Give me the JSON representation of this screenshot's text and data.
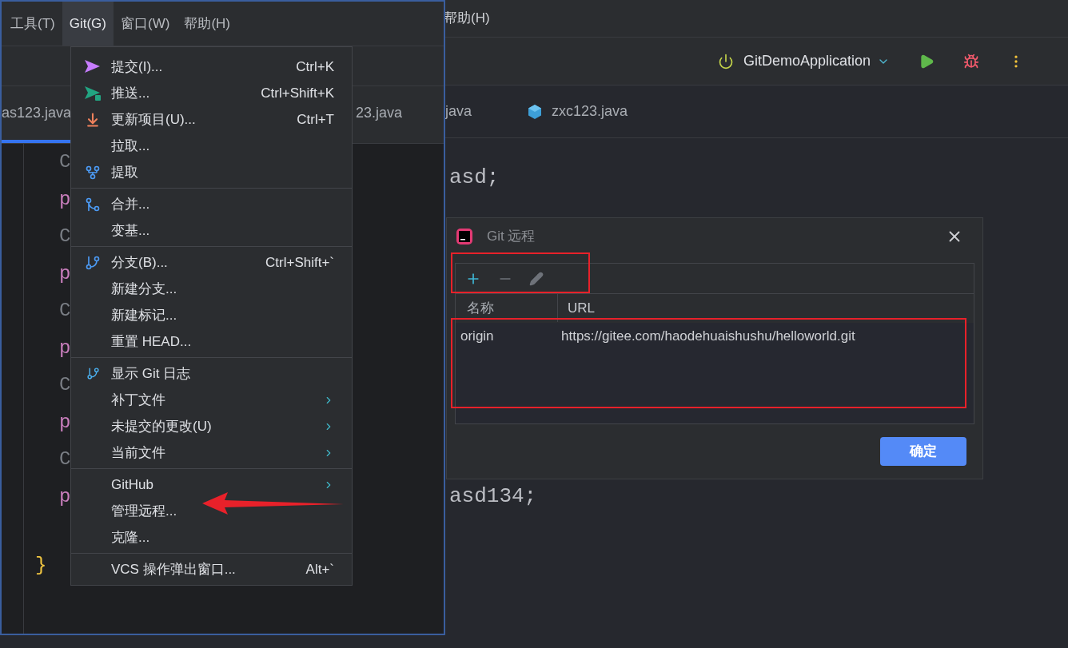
{
  "background_window": {
    "menu_tail": "帮助(H)",
    "run_config": "GitDemoApplication",
    "tabs": [
      {
        "label": "java",
        "icon": false
      },
      {
        "label": "zxc123.java",
        "icon": true
      }
    ],
    "code_lines": [
      "asd;",
      "asd134;"
    ]
  },
  "front_window": {
    "menu_bar": [
      {
        "label": "工具(T)",
        "selected": false
      },
      {
        "label": "Git(G)",
        "selected": true
      },
      {
        "label": "窗口(W)",
        "selected": false
      },
      {
        "label": "帮助(H)",
        "selected": false
      }
    ],
    "tabs": [
      {
        "label": "as123.java",
        "selected": true
      },
      {
        "label": "23.java",
        "selected": false
      }
    ],
    "code_fragments": [
      "C",
      "p",
      "C",
      "p",
      "C",
      "p",
      "C",
      "p",
      "C",
      "p"
    ],
    "closing_brace": "}"
  },
  "git_menu": {
    "groups": [
      [
        {
          "label": "提交(I)...",
          "shortcut": "Ctrl+K",
          "kind": "commit",
          "submenu": false
        },
        {
          "label": "推送...",
          "shortcut": "Ctrl+Shift+K",
          "kind": "push",
          "submenu": false
        },
        {
          "label": "更新项目(U)...",
          "shortcut": "Ctrl+T",
          "kind": "update",
          "submenu": false
        },
        {
          "label": "拉取...",
          "kind": "plain",
          "submenu": false
        },
        {
          "label": "提取",
          "kind": "fetch",
          "submenu": false
        }
      ],
      [
        {
          "label": "合并...",
          "kind": "merge",
          "submenu": false
        },
        {
          "label": "变基...",
          "kind": "plain",
          "submenu": false
        }
      ],
      [
        {
          "label": "分支(B)...",
          "shortcut": "Ctrl+Shift+`",
          "kind": "branch",
          "submenu": false
        },
        {
          "label": "新建分支...",
          "kind": "plain",
          "submenu": false
        },
        {
          "label": "新建标记...",
          "kind": "plain",
          "submenu": false
        },
        {
          "label": "重置 HEAD...",
          "kind": "plain",
          "submenu": false
        }
      ],
      [
        {
          "label": "显示 Git 日志",
          "kind": "log",
          "submenu": false
        },
        {
          "label": "补丁文件",
          "kind": "plain",
          "submenu": true
        },
        {
          "label": "未提交的更改(U)",
          "kind": "plain",
          "submenu": true
        },
        {
          "label": "当前文件",
          "kind": "plain",
          "submenu": true
        }
      ],
      [
        {
          "label": "GitHub",
          "kind": "plain",
          "submenu": true
        },
        {
          "label": "管理远程...",
          "kind": "plain",
          "submenu": false
        },
        {
          "label": "克隆...",
          "kind": "plain",
          "submenu": false
        }
      ],
      [
        {
          "label": "VCS 操作弹出窗口...",
          "shortcut": "Alt+`",
          "kind": "plain",
          "submenu": false
        }
      ]
    ]
  },
  "dialog": {
    "title": "Git 远程",
    "columns": [
      "名称",
      "URL"
    ],
    "rows": [
      {
        "name": "origin",
        "url": "https://gitee.com/haodehuaishushu/helloworld.git"
      }
    ],
    "ok_button": "确定"
  }
}
